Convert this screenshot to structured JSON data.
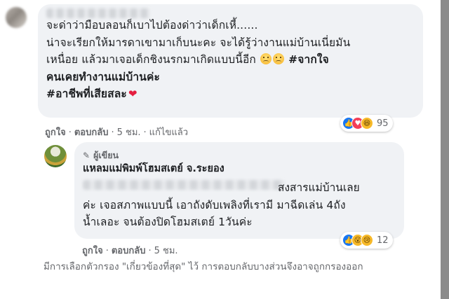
{
  "comment1": {
    "lines": [
      "จะด่าว่ามือบลอนก็เบาไปต้องด่าว่าเด็กเหี้......",
      "น่าจะเรียกให้มารดาเขามาเก็บนะคะ จะได้รู้ว่างานแม่บ้านเนี่ยมัน",
      "เหนื่อย แล้วมาเจอเด็กชิงนรกมาเกิดแบบนี้อีก"
    ],
    "hashtag1a": "#จากใจ",
    "hashtag1b": "คนเคยทำงานแม่บ้านค่ะ",
    "hashtag2": "#อาชีพที่เสียสละ",
    "heart": "❤",
    "actions": {
      "like": "ถูกใจ",
      "reply": "ตอบกลับ",
      "time": "5 ชม.",
      "edited": "แก้ไขแล้ว"
    },
    "reaction_count": "95"
  },
  "reply": {
    "author_badge": "ผู้เขียน",
    "page_name": "แหลมแม่พิมพ์โฮมสเตย์ จ.ระยอง",
    "line1_end": "สงสารแม่บ้านเลย",
    "lines": [
      "ค่ะ เจอสภาพแบบนี้ เอาถังดับเพลิงที่เรามี มาฉีดเล่น 4ถัง",
      "น้ำเลอะ จนต้องปิดโฮมสเตย์ 1วันค่ะ"
    ],
    "actions": {
      "like": "ถูกใจ",
      "reply": "ตอบกลับ",
      "time": "5 ชม."
    },
    "reaction_count": "12"
  },
  "notice": "มีการเลือกตัวกรอง \"เกี่ยวข้องที่สุด\" ไว้ การตอบกลับบางส่วนจึงอาจถูกกรองออก",
  "colors": {
    "bubble": "#f0f2f5",
    "meta_text": "#65676b",
    "like": "#1877f2",
    "love": "#f33e58",
    "yellow_reaction": "#f7b928"
  },
  "icons": {
    "pen": "pencil-icon",
    "reactions1": [
      "like-icon",
      "love-icon",
      "haha-icon"
    ],
    "reactions2": [
      "like-icon",
      "wow-icon",
      "sad-icon"
    ]
  }
}
